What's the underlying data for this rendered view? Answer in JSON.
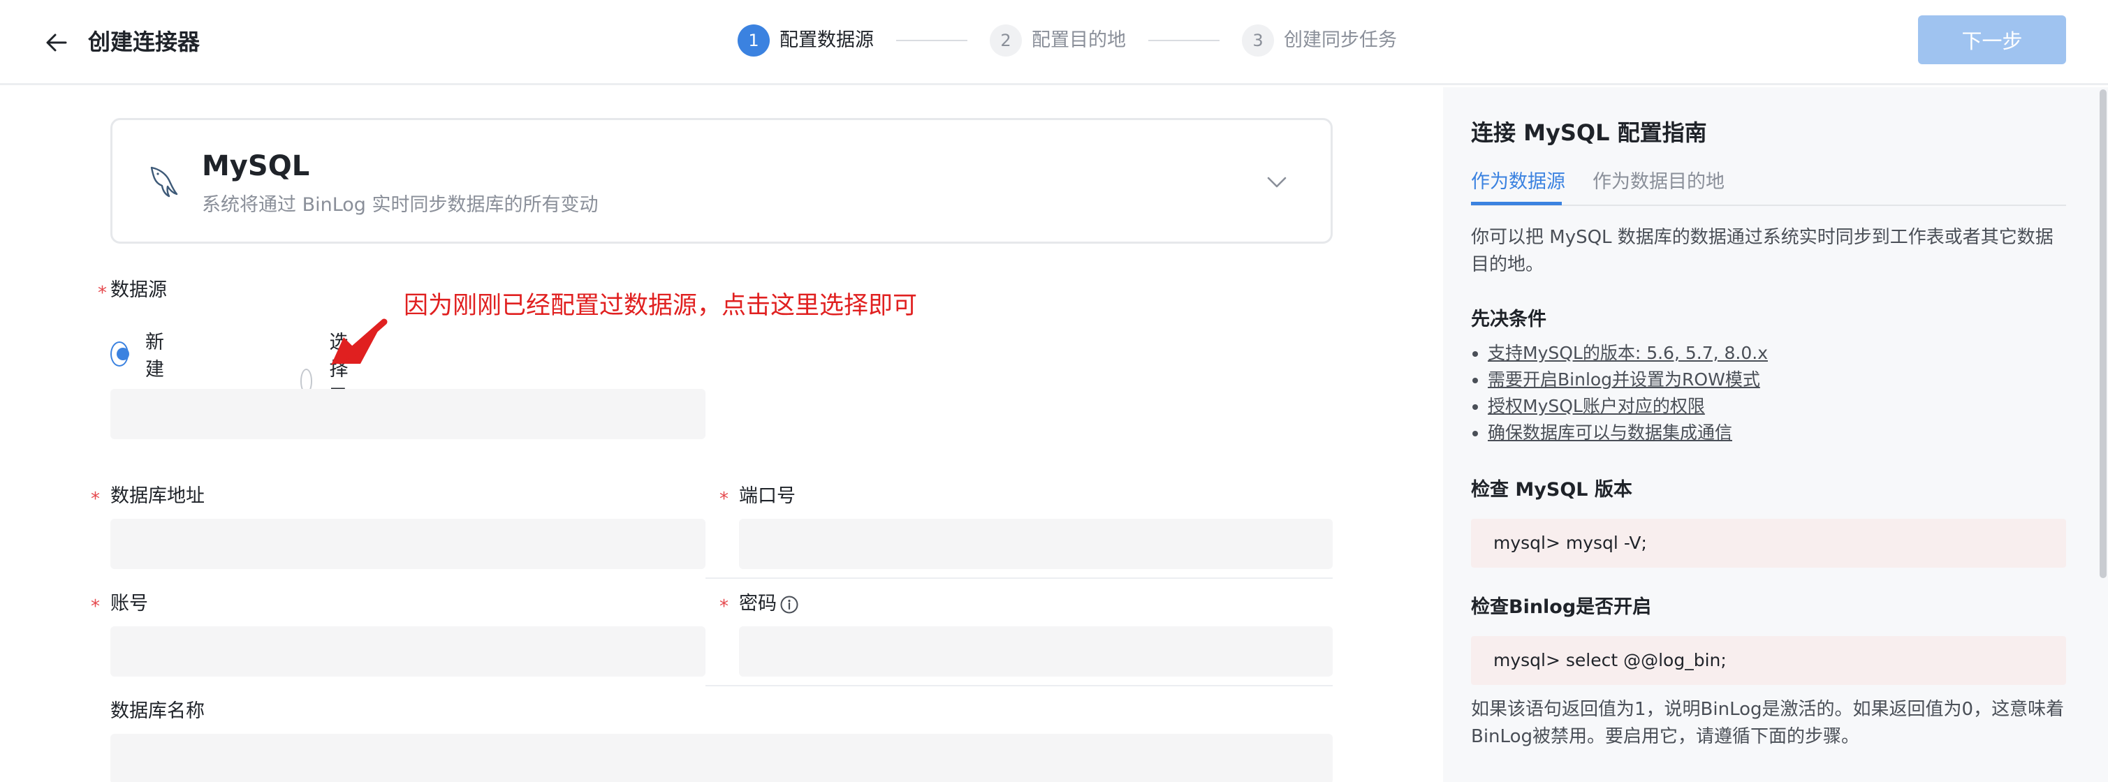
{
  "header": {
    "title": "创建连接器",
    "steps": [
      {
        "num": "1",
        "label": "配置数据源"
      },
      {
        "num": "2",
        "label": "配置目的地"
      },
      {
        "num": "3",
        "label": "创建同步任务"
      }
    ],
    "next_label": "下一步"
  },
  "connector": {
    "name": "MySQL",
    "description": "系统将通过 BinLog 实时同步数据库的所有变动"
  },
  "form": {
    "datasource_label": "数据源",
    "radio_new": "新建",
    "radio_existing": "选择已有",
    "annotation": "因为刚刚已经配置过数据源，点击这里选择即可",
    "db_address_label": "数据库地址",
    "port_label": "端口号",
    "account_label": "账号",
    "password_label": "密码",
    "db_name_label": "数据库名称",
    "required_mark": "*"
  },
  "guide": {
    "title": "连接 MySQL 配置指南",
    "tabs": [
      "作为数据源",
      "作为数据目的地"
    ],
    "intro": "你可以把 MySQL 数据库的数据通过系统实时同步到工作表或者其它数据目的地。",
    "prereq_title": "先决条件",
    "prereqs": [
      "支持MySQL的版本: 5.6, 5.7, 8.0.x",
      "需要开启Binlog并设置为ROW模式",
      "授权MySQL账户对应的权限",
      "确保数据库可以与数据集成通信"
    ],
    "check_version_title": "检查 MySQL 版本",
    "check_version_code": "mysql> mysql -V;",
    "check_binlog_title": "检查Binlog是否开启",
    "check_binlog_code": "mysql> select @@log_bin;",
    "binlog_note": "如果该语句返回值为1，说明BinLog是激活的。如果返回值为0，这意味着BinLog被禁用。要启用它，请遵循下面的步骤。"
  },
  "colors": {
    "accent": "#3b82e0",
    "annotation": "#e02020",
    "required": "#e5484d"
  }
}
